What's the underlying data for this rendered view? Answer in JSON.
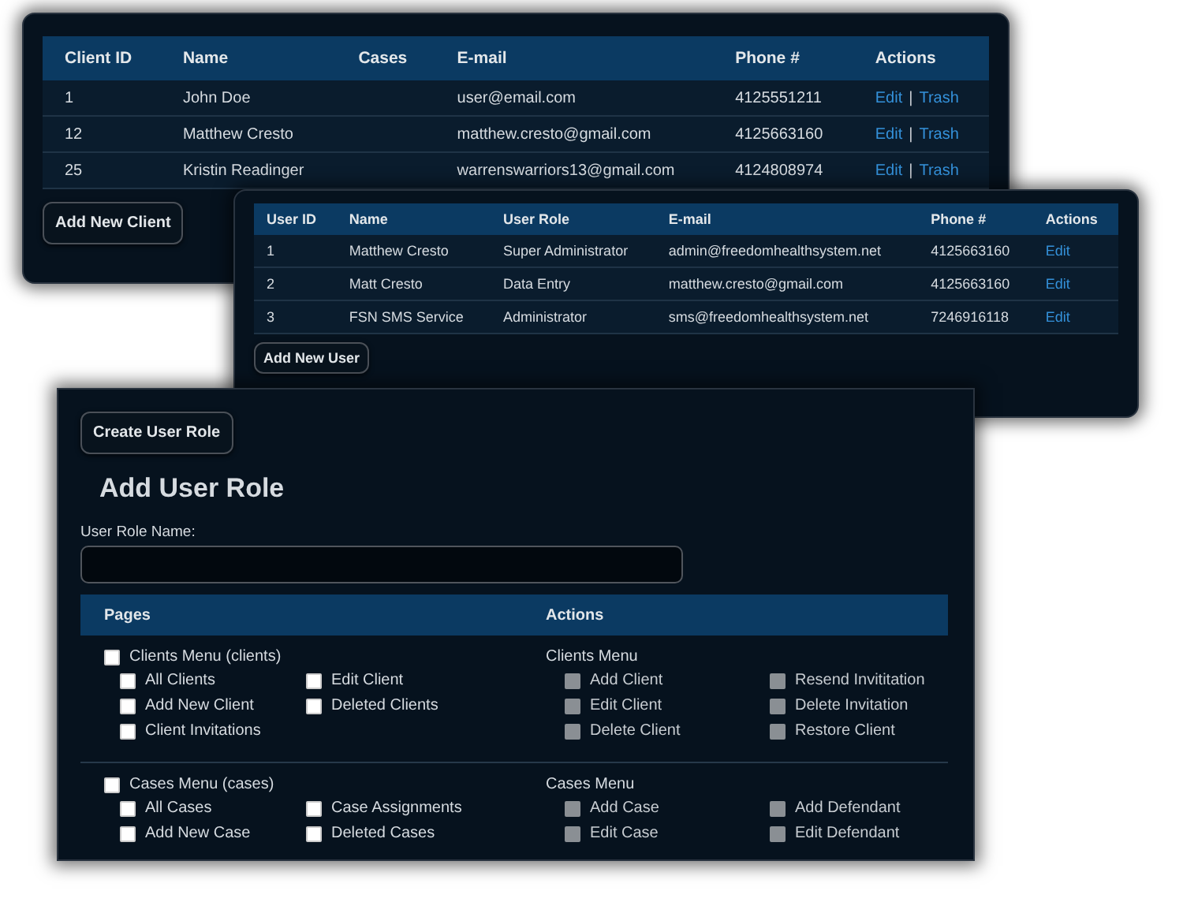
{
  "clients_panel": {
    "columns": [
      "Client ID",
      "Name",
      "Cases",
      "E-mail",
      "Phone #",
      "Actions"
    ],
    "rows": [
      {
        "cells": [
          "1",
          "John Doe",
          "",
          "user@email.com",
          "4125551211"
        ],
        "actions": [
          "Edit",
          "Trash"
        ]
      },
      {
        "cells": [
          "12",
          "Matthew Cresto",
          "",
          "matthew.cresto@gmail.com",
          "4125663160"
        ],
        "actions": [
          "Edit",
          "Trash"
        ]
      },
      {
        "cells": [
          "25",
          "Kristin Readinger",
          "",
          "warrenswarriors13@gmail.com",
          "4124808974"
        ],
        "actions": [
          "Edit",
          "Trash"
        ]
      }
    ],
    "separator": "|",
    "button": "Add New Client"
  },
  "users_panel": {
    "columns": [
      "User ID",
      "Name",
      "User Role",
      "E-mail",
      "Phone #",
      "Actions"
    ],
    "rows": [
      {
        "cells": [
          "1",
          "Matthew Cresto",
          "Super Administrator",
          "admin@freedomhealthsystem.net",
          "4125663160"
        ],
        "actions": [
          "Edit"
        ]
      },
      {
        "cells": [
          "2",
          "Matt Cresto",
          "Data Entry",
          "matthew.cresto@gmail.com",
          "4125663160"
        ],
        "actions": [
          "Edit"
        ]
      },
      {
        "cells": [
          "3",
          "FSN SMS Service",
          "Administrator",
          "sms@freedomhealthsystem.net",
          "7246916118"
        ],
        "actions": [
          "Edit"
        ]
      }
    ],
    "button": "Add New User"
  },
  "role_form": {
    "button": "Create User Role",
    "title": "Add User Role",
    "name_label": "User Role Name:",
    "columns": [
      "Pages",
      "Actions"
    ],
    "groups": [
      {
        "page": {
          "label": "Clients Menu (clients)",
          "checked": false
        },
        "pages": [
          {
            "label": "All Clients",
            "checked": false
          },
          {
            "label": "Edit Client",
            "checked": false
          },
          {
            "label": "Add New Client",
            "checked": false
          },
          {
            "label": "Deleted Clients",
            "checked": false
          },
          {
            "label": "Client Invitations",
            "checked": false
          }
        ],
        "actions_title": "Clients Menu",
        "actions": [
          {
            "label": "Add Client",
            "checked": false,
            "disabled": true
          },
          {
            "label": "Resend Invititation",
            "checked": false,
            "disabled": true
          },
          {
            "label": "Edit Client",
            "checked": false,
            "disabled": true
          },
          {
            "label": "Delete Invitation",
            "checked": false,
            "disabled": true
          },
          {
            "label": "Delete Client",
            "checked": false,
            "disabled": true
          },
          {
            "label": "Restore Client",
            "checked": false,
            "disabled": true
          }
        ]
      },
      {
        "page": {
          "label": "Cases Menu (cases)",
          "checked": false
        },
        "pages": [
          {
            "label": "All Cases",
            "checked": false
          },
          {
            "label": "Case Assignments",
            "checked": false
          },
          {
            "label": "Add New Case",
            "checked": false
          },
          {
            "label": "Deleted Cases",
            "checked": false
          }
        ],
        "actions_title": "Cases Menu",
        "actions": [
          {
            "label": "Add Case",
            "checked": false,
            "disabled": true
          },
          {
            "label": "Add Defendant",
            "checked": false,
            "disabled": true
          },
          {
            "label": "Edit Case",
            "checked": false,
            "disabled": true
          },
          {
            "label": "Edit Defendant",
            "checked": false,
            "disabled": true
          }
        ]
      }
    ]
  }
}
